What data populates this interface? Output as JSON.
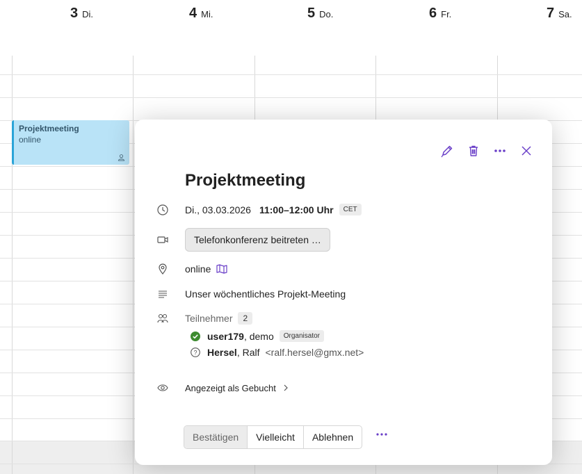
{
  "days": [
    {
      "num": "3",
      "name": "Di."
    },
    {
      "num": "4",
      "name": "Mi."
    },
    {
      "num": "5",
      "name": "Do."
    },
    {
      "num": "6",
      "name": "Fr."
    },
    {
      "num": "7",
      "name": "Sa."
    }
  ],
  "event": {
    "title": "Projektmeeting",
    "location": "online"
  },
  "popover": {
    "title": "Projektmeeting",
    "date": "Di., 03.03.2026",
    "time": "11:00–12:00 Uhr",
    "timezone": "CET",
    "conference_button": "Telefonkonferenz beitreten …",
    "location": "online",
    "description": "Unser wöchentliches Projekt-Meeting",
    "attendees_label": "Teilnehmer",
    "attendees_count": "2",
    "attendees": [
      {
        "name": "user179",
        "rest": ", demo",
        "badge": "Organisator",
        "status": "accepted"
      },
      {
        "name": "Hersel",
        "rest": ", Ralf",
        "email": "<ralf.hersel@gmx.net>",
        "status": "unknown"
      }
    ],
    "visibility": "Angezeigt als Gebucht",
    "rsvp": {
      "accept": "Bestätigen",
      "maybe": "Vielleicht",
      "decline": "Ablehnen"
    }
  },
  "colors": {
    "accent": "#6a3fc8",
    "event_bg": "#b9e3f7",
    "event_border": "#2aa4d8",
    "accepted": "#3d8b2f"
  },
  "icons": [
    "edit-icon",
    "delete-icon",
    "more-icon",
    "close-icon",
    "clock-icon",
    "video-icon",
    "location-icon",
    "map-icon",
    "description-icon",
    "attendees-icon",
    "check-circle-icon",
    "question-circle-icon",
    "eye-icon",
    "chevron-right-icon",
    "person-icon"
  ]
}
